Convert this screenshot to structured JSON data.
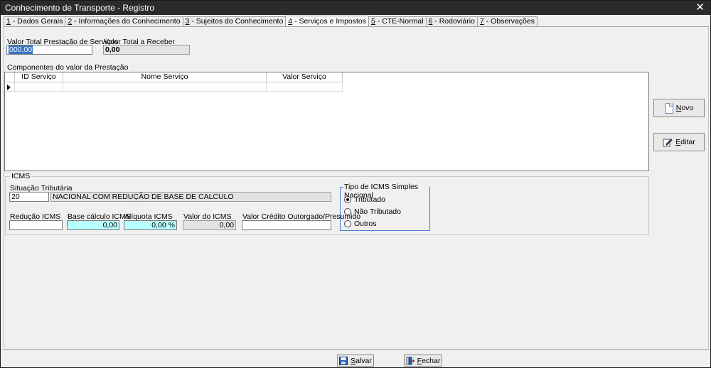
{
  "window": {
    "title": "Conhecimento de Transporte - Registro",
    "close_glyph": "✕"
  },
  "tabs": [
    {
      "key": "1",
      "label": " - Dados Gerais"
    },
    {
      "key": "2",
      "label": " - Informações do Conhecimento"
    },
    {
      "key": "3",
      "label": " - Sujeitos do Conhecimento"
    },
    {
      "key": "4",
      "label": " - Serviços e Impostos"
    },
    {
      "key": "5",
      "label": " - CTE-Normal"
    },
    {
      "key": "6",
      "label": " - Rodoviário"
    },
    {
      "key": "7",
      "label": " - Observações"
    }
  ],
  "active_tab": 3,
  "prestacao": {
    "total_label": "Valor Total Prestação de Serviços",
    "total_value": "000,00",
    "receber_label": "Valor Total a Receber",
    "receber_value": "0,00"
  },
  "componentes": {
    "label": "Componentes do valor da Prestação",
    "columns": [
      "ID Serviço",
      "Nome Serviço",
      "Valor Serviço"
    ]
  },
  "buttons": {
    "novo": {
      "mnemonic": "N",
      "rest": "ovo"
    },
    "editar": {
      "mnemonic": "E",
      "rest": "ditar"
    },
    "salvar": {
      "mnemonic": "S",
      "rest": "alvar"
    },
    "fechar": {
      "mnemonic": "F",
      "rest": "echar"
    }
  },
  "icms": {
    "group_label": "ICMS",
    "situacao_label": "Situação Tributária",
    "situacao_code": "20",
    "situacao_desc": "NACIONAL COM REDUÇÃO DE BASE DE CALCULO",
    "reducao_label": "Redução ICMS",
    "reducao_value": "",
    "base_label": "Base cálculo ICMS",
    "base_value": "0,00",
    "aliquota_label": "Alíquota ICMS",
    "aliquota_value": "0,00 %",
    "valor_label": "Valor do ICMS",
    "valor_value": "0,00",
    "credito_label": "Valor Crédito Outorgado/Presumido",
    "credito_value": ""
  },
  "simples": {
    "label": "Tipo de ICMS Simples Nacional",
    "options": [
      "Tributado",
      "Não Tributado",
      "Outros"
    ],
    "selected": "Tributado"
  }
}
